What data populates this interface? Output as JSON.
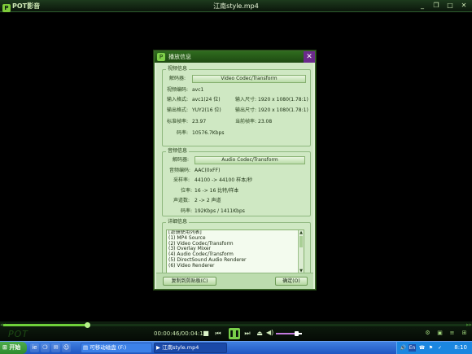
{
  "player": {
    "app_name": "POT影音",
    "window_title": "江南style.mp4",
    "btn_min": "_",
    "btn_restore": "❐",
    "btn_max": "□",
    "btn_close": "✕"
  },
  "dialog": {
    "title": "播放信息",
    "close": "✕",
    "video": {
      "legend": "视频信息",
      "decoder_label": "解码器:",
      "decoder_value": "Video Codec/Transform",
      "codec_label": "视频编码:",
      "codec_value": "avc1",
      "input_fmt_label": "输入格式:",
      "input_fmt_value": "avc1(24 位)",
      "input_size_label": "输入尺寸:",
      "input_size_value": "1920 x 1080(1.78:1)",
      "output_fmt_label": "输出格式:",
      "output_fmt_value": "YUY2(16 位)",
      "output_size_label": "输出尺寸:",
      "output_size_value": "1920 x 1080(1.78:1)",
      "std_fps_label": "标准帧率:",
      "std_fps_value": "23.97",
      "cur_fps_label": "当前帧率:",
      "cur_fps_value": "23.08",
      "bitrate_label": "码率:",
      "bitrate_value": "10576.7Kbps"
    },
    "audio": {
      "legend": "音频信息",
      "decoder_label": "解码器:",
      "decoder_value": "Audio Codec/Transform",
      "codec_label": "音频编码:",
      "codec_value": "AAC(0xFF)",
      "sample_label": "采样率:",
      "sample_value": "44100 -> 44100 样本/秒",
      "bits_label": "位率:",
      "bits_value": "16 -> 16 比特/样本",
      "channels_label": "声道数:",
      "channels_value": "2 -> 2 声道",
      "bitrate_label": "码率:",
      "bitrate_value": "192Kbps / 1411Kbps"
    },
    "details": {
      "legend": "详细信息",
      "items": [
        "[滤镜使用列表]",
        "(1) MP4 Source",
        "(2) Video Codec/Transform",
        "(3) Overlay Mixer",
        "(4) Audio Codec/Transform",
        "(5) DirectSound Audio Renderer",
        "(6) Video Renderer"
      ]
    },
    "copy_button": "复制到剪贴板(C)",
    "ok_button": "确定(O)"
  },
  "controls": {
    "time": "00:00:46/00:04:12",
    "progress": 0.18,
    "volume": 0.78,
    "logo_text": "POT",
    "stop": "■",
    "prev": "⏮",
    "play": "❚❚",
    "next": "⏭",
    "eject": "⏏",
    "vol_icon": "◀)",
    "scroll_left": "◂◂",
    "scroll_right": "▸▸",
    "right_icons": [
      "⚙",
      "▣",
      "≡",
      "⊞"
    ]
  },
  "taskbar": {
    "start": "开始",
    "quick_icons": [
      "ie",
      "❍",
      "✉",
      "☺"
    ],
    "tasks": [
      "可移动磁盘 (F:)",
      "江南style.mp4"
    ],
    "tray_icons": [
      "🔊",
      "En",
      "☎",
      "⚑",
      "✓"
    ],
    "clock": "8:10"
  }
}
